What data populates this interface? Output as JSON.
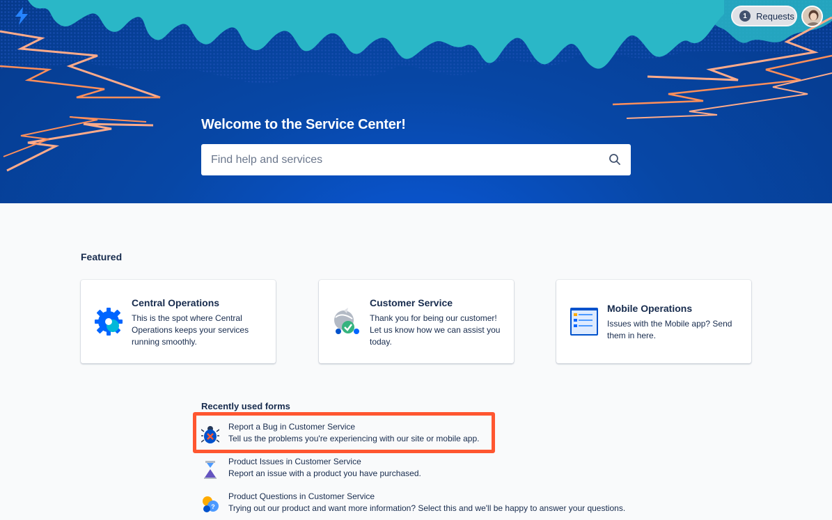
{
  "header": {
    "logo_icon": "jira-service-management-bolt-icon",
    "requests_label": "Requests",
    "requests_count": "1",
    "avatar_icon": "user-avatar"
  },
  "hero": {
    "title": "Welcome to the Service Center!",
    "search_placeholder": "Find help and services",
    "search_icon": "search-icon"
  },
  "featured": {
    "heading": "Featured",
    "cards": [
      {
        "title": "Central Operations",
        "description": "This is the spot where Central Operations keeps your services running smoothly.",
        "icon": "gear-icon"
      },
      {
        "title": "Customer Service",
        "description": "Thank you for being our customer! Let us know how we can assist you today.",
        "icon": "customer-service-globe-icon"
      },
      {
        "title": "Mobile Operations",
        "description": "Issues with the Mobile app? Send them in here.",
        "icon": "mobile-browser-icon"
      }
    ]
  },
  "recent_forms": {
    "heading": "Recently used forms",
    "items": [
      {
        "title": "Report a Bug in Customer Service",
        "description": "Tell us the problems you're experiencing with our site or mobile app.",
        "icon": "bug-icon"
      },
      {
        "title": "Product Issues in Customer Service",
        "description": "Report an issue with a product you have purchased.",
        "icon": "hourglass-icon"
      },
      {
        "title": "Product Questions in Customer Service",
        "description": "Trying out our product and want more information? Select this and we'll be happy to answer your questions.",
        "icon": "question-bubbles-icon"
      }
    ]
  },
  "colors": {
    "hero_blue": "#0747a6",
    "accent_highlight": "#ff5630",
    "text": "#172b4d"
  }
}
